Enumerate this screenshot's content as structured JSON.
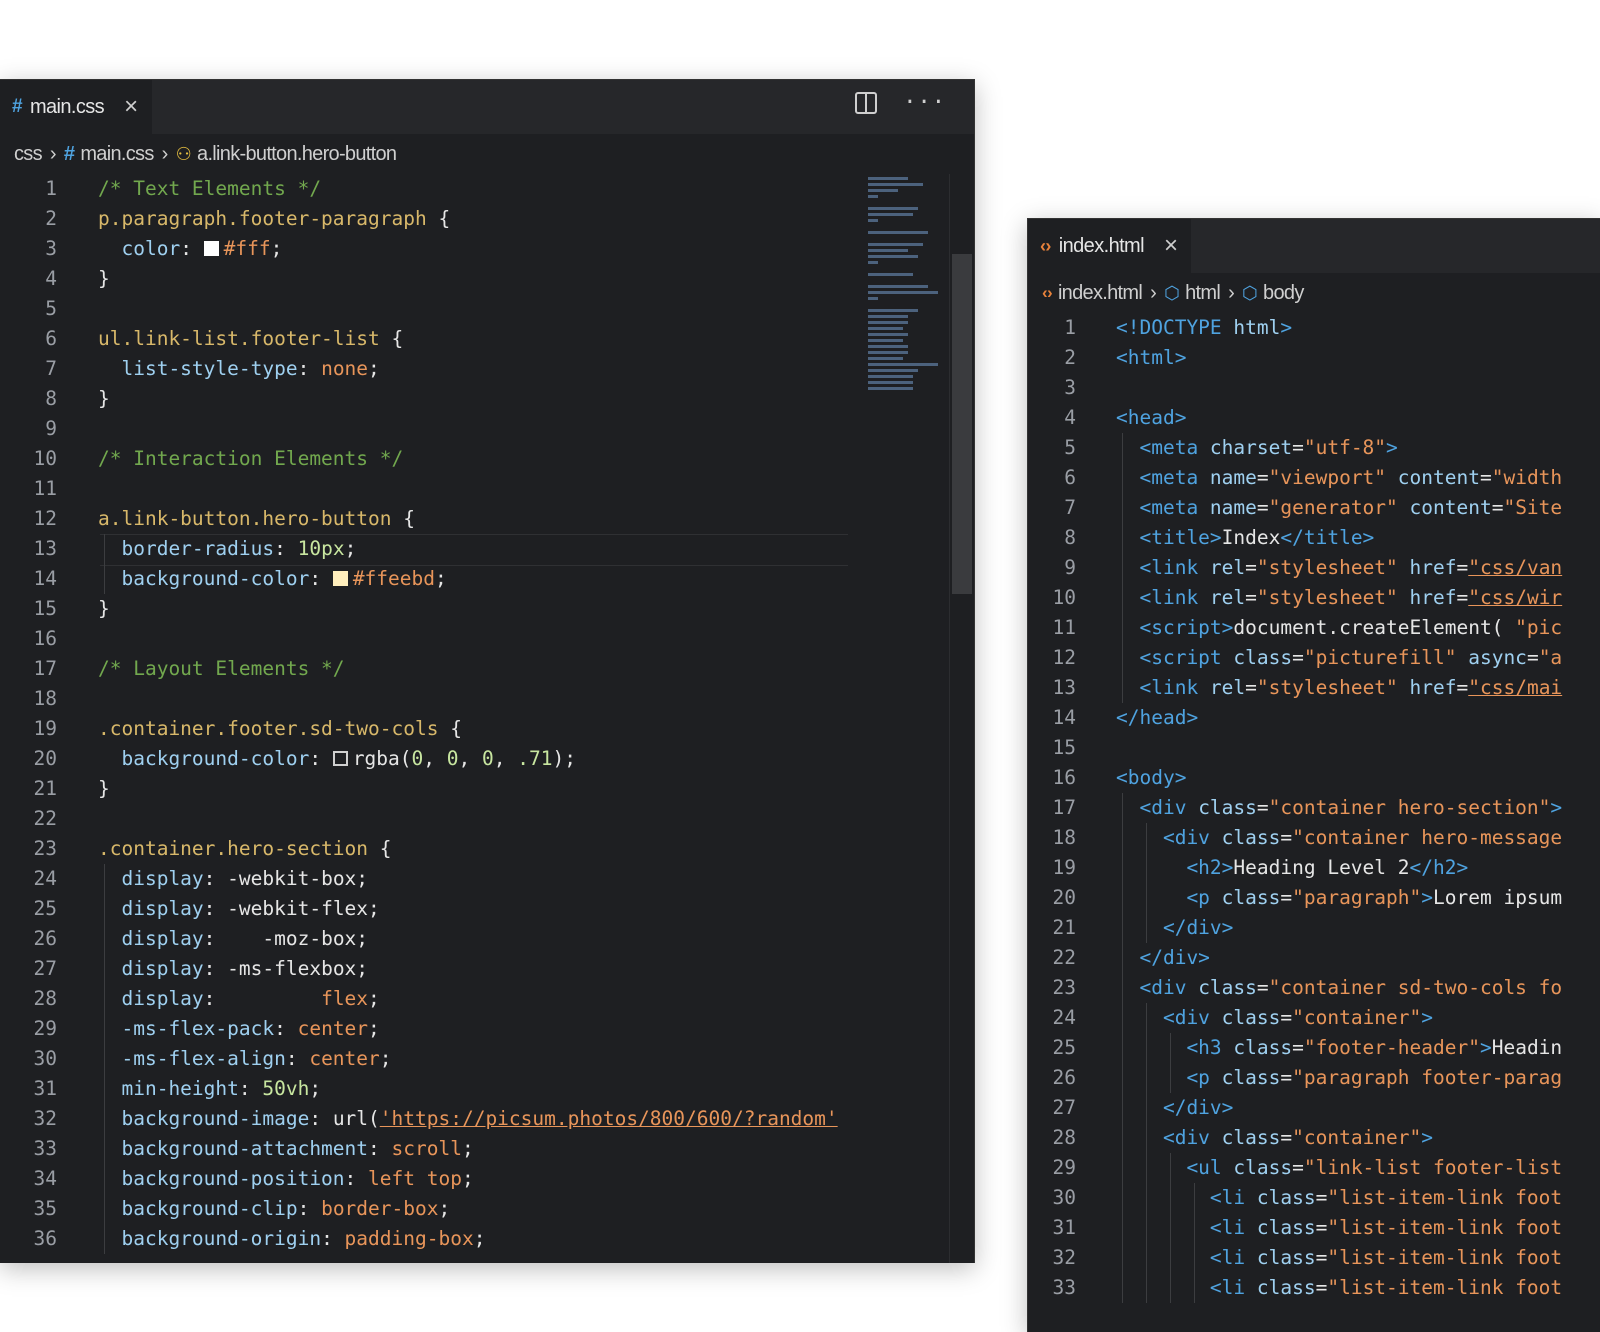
{
  "css_editor": {
    "tab": {
      "label": "main.css",
      "icon": "css-hash-icon"
    },
    "breadcrumb": [
      "css",
      "main.css",
      "a.link-button.hero-button"
    ],
    "lines": [
      {
        "n": "1",
        "parts": [
          [
            "cm",
            "/* Text Elements */"
          ]
        ]
      },
      {
        "n": "2",
        "parts": [
          [
            "sel",
            "p.paragraph.footer-paragraph"
          ],
          [
            "br",
            " {"
          ]
        ]
      },
      {
        "n": "3",
        "parts": [
          [
            "pr",
            "  color"
          ],
          [
            "br",
            ": "
          ],
          [
            "sw",
            "#ffffff"
          ],
          [
            "vl",
            "#fff"
          ],
          [
            "br",
            ";"
          ]
        ]
      },
      {
        "n": "4",
        "parts": [
          [
            "br",
            "}"
          ]
        ]
      },
      {
        "n": "5",
        "parts": []
      },
      {
        "n": "6",
        "parts": [
          [
            "sel",
            "ul.link-list.footer-list"
          ],
          [
            "br",
            " {"
          ]
        ]
      },
      {
        "n": "7",
        "parts": [
          [
            "pr",
            "  list-style-type"
          ],
          [
            "br",
            ": "
          ],
          [
            "vl",
            "none"
          ],
          [
            "br",
            ";"
          ]
        ]
      },
      {
        "n": "8",
        "parts": [
          [
            "br",
            "}"
          ]
        ]
      },
      {
        "n": "9",
        "parts": []
      },
      {
        "n": "10",
        "parts": [
          [
            "cm",
            "/* Interaction Elements */"
          ]
        ]
      },
      {
        "n": "11",
        "parts": []
      },
      {
        "n": "12",
        "parts": [
          [
            "sel",
            "a.link-button.hero-button"
          ],
          [
            "br",
            " {"
          ]
        ]
      },
      {
        "n": "13",
        "parts": [
          [
            "pr",
            "  border-radius"
          ],
          [
            "br",
            ": "
          ],
          [
            "nm",
            "10px"
          ],
          [
            "br",
            ";"
          ]
        ]
      },
      {
        "n": "14",
        "parts": [
          [
            "pr",
            "  background-color"
          ],
          [
            "br",
            ": "
          ],
          [
            "sw",
            "#ffeebd"
          ],
          [
            "vl",
            "#ffeebd"
          ],
          [
            "br",
            ";"
          ]
        ]
      },
      {
        "n": "15",
        "parts": [
          [
            "br",
            "}"
          ]
        ]
      },
      {
        "n": "16",
        "parts": []
      },
      {
        "n": "17",
        "parts": [
          [
            "cm",
            "/* Layout Elements */"
          ]
        ]
      },
      {
        "n": "18",
        "parts": []
      },
      {
        "n": "19",
        "parts": [
          [
            "sel",
            ".container.footer.sd-two-cols"
          ],
          [
            "br",
            " {"
          ]
        ]
      },
      {
        "n": "20",
        "parts": [
          [
            "pr",
            "  background-color"
          ],
          [
            "br",
            ": "
          ],
          [
            "sw",
            "empty"
          ],
          [
            "tx",
            "rgba("
          ],
          [
            "nm",
            "0"
          ],
          [
            "tx",
            ", "
          ],
          [
            "nm",
            "0"
          ],
          [
            "tx",
            ", "
          ],
          [
            "nm",
            "0"
          ],
          [
            "tx",
            ", "
          ],
          [
            "nm",
            ".71"
          ],
          [
            "tx",
            ")"
          ],
          [
            "br",
            ";"
          ]
        ]
      },
      {
        "n": "21",
        "parts": [
          [
            "br",
            "}"
          ]
        ]
      },
      {
        "n": "22",
        "parts": []
      },
      {
        "n": "23",
        "parts": [
          [
            "sel",
            ".container.hero-section"
          ],
          [
            "br",
            " {"
          ]
        ]
      },
      {
        "n": "24",
        "parts": [
          [
            "pr",
            "  display"
          ],
          [
            "br",
            ": "
          ],
          [
            "tx",
            "-webkit-box"
          ],
          [
            "br",
            ";"
          ]
        ]
      },
      {
        "n": "25",
        "parts": [
          [
            "pr",
            "  display"
          ],
          [
            "br",
            ": "
          ],
          [
            "tx",
            "-webkit-flex"
          ],
          [
            "br",
            ";"
          ]
        ]
      },
      {
        "n": "26",
        "parts": [
          [
            "pr",
            "  display"
          ],
          [
            "br",
            ":    "
          ],
          [
            "tx",
            "-moz-box"
          ],
          [
            "br",
            ";"
          ]
        ]
      },
      {
        "n": "27",
        "parts": [
          [
            "pr",
            "  display"
          ],
          [
            "br",
            ": "
          ],
          [
            "tx",
            "-ms-flexbox"
          ],
          [
            "br",
            ";"
          ]
        ]
      },
      {
        "n": "28",
        "parts": [
          [
            "pr",
            "  display"
          ],
          [
            "br",
            ":         "
          ],
          [
            "vl",
            "flex"
          ],
          [
            "br",
            ";"
          ]
        ]
      },
      {
        "n": "29",
        "parts": [
          [
            "pr",
            "  -ms-flex-pack"
          ],
          [
            "br",
            ": "
          ],
          [
            "vl",
            "center"
          ],
          [
            "br",
            ";"
          ]
        ]
      },
      {
        "n": "30",
        "parts": [
          [
            "pr",
            "  -ms-flex-align"
          ],
          [
            "br",
            ": "
          ],
          [
            "vl",
            "center"
          ],
          [
            "br",
            ";"
          ]
        ]
      },
      {
        "n": "31",
        "parts": [
          [
            "pr",
            "  min-height"
          ],
          [
            "br",
            ": "
          ],
          [
            "nm",
            "50vh"
          ],
          [
            "br",
            ";"
          ]
        ]
      },
      {
        "n": "32",
        "parts": [
          [
            "pr",
            "  background-image"
          ],
          [
            "br",
            ": "
          ],
          [
            "tx",
            "url("
          ],
          [
            "url",
            "'https://picsum.photos/800/600/?random'"
          ]
        ]
      },
      {
        "n": "33",
        "parts": [
          [
            "pr",
            "  background-attachment"
          ],
          [
            "br",
            ": "
          ],
          [
            "vl",
            "scroll"
          ],
          [
            "br",
            ";"
          ]
        ]
      },
      {
        "n": "34",
        "parts": [
          [
            "pr",
            "  background-position"
          ],
          [
            "br",
            ": "
          ],
          [
            "vl",
            "left top"
          ],
          [
            "br",
            ";"
          ]
        ]
      },
      {
        "n": "35",
        "parts": [
          [
            "pr",
            "  background-clip"
          ],
          [
            "br",
            ": "
          ],
          [
            "vl",
            "border-box"
          ],
          [
            "br",
            ";"
          ]
        ]
      },
      {
        "n": "36",
        "parts": [
          [
            "pr",
            "  background-origin"
          ],
          [
            "br",
            ": "
          ],
          [
            "vl",
            "padding-box"
          ],
          [
            "br",
            ";"
          ]
        ]
      }
    ]
  },
  "html_editor": {
    "tab": {
      "label": "index.html",
      "icon": "html-file-icon"
    },
    "breadcrumb": [
      "index.html",
      "html",
      "body"
    ],
    "lines": [
      {
        "n": "1",
        "parts": [
          [
            "tg",
            "<!DOCTYPE "
          ],
          [
            "at",
            "html"
          ],
          [
            "tg",
            ">"
          ]
        ]
      },
      {
        "n": "2",
        "parts": [
          [
            "tg",
            "<html>"
          ]
        ]
      },
      {
        "n": "3",
        "parts": []
      },
      {
        "n": "4",
        "parts": [
          [
            "tg",
            "<head>"
          ]
        ]
      },
      {
        "n": "5",
        "parts": [
          [
            "tg",
            "  <meta "
          ],
          [
            "at",
            "charset"
          ],
          [
            "tx",
            "="
          ],
          [
            "st",
            "\"utf-8\""
          ],
          [
            "tg",
            ">"
          ]
        ]
      },
      {
        "n": "6",
        "parts": [
          [
            "tg",
            "  <meta "
          ],
          [
            "at",
            "name"
          ],
          [
            "tx",
            "="
          ],
          [
            "st",
            "\"viewport\""
          ],
          [
            "at",
            " content"
          ],
          [
            "tx",
            "="
          ],
          [
            "st",
            "\"width"
          ]
        ]
      },
      {
        "n": "7",
        "parts": [
          [
            "tg",
            "  <meta "
          ],
          [
            "at",
            "name"
          ],
          [
            "tx",
            "="
          ],
          [
            "st",
            "\"generator\""
          ],
          [
            "at",
            " content"
          ],
          [
            "tx",
            "="
          ],
          [
            "st",
            "\"Site"
          ]
        ]
      },
      {
        "n": "8",
        "parts": [
          [
            "tg",
            "  <title>"
          ],
          [
            "tx",
            "Index"
          ],
          [
            "tg",
            "</title>"
          ]
        ]
      },
      {
        "n": "9",
        "parts": [
          [
            "tg",
            "  <link "
          ],
          [
            "at",
            "rel"
          ],
          [
            "tx",
            "="
          ],
          [
            "st",
            "\"stylesheet\""
          ],
          [
            "at",
            " href"
          ],
          [
            "tx",
            "="
          ],
          [
            "url",
            "\"css/van"
          ]
        ]
      },
      {
        "n": "10",
        "parts": [
          [
            "tg",
            "  <link "
          ],
          [
            "at",
            "rel"
          ],
          [
            "tx",
            "="
          ],
          [
            "st",
            "\"stylesheet\""
          ],
          [
            "at",
            " href"
          ],
          [
            "tx",
            "="
          ],
          [
            "url",
            "\"css/wir"
          ]
        ]
      },
      {
        "n": "11",
        "parts": [
          [
            "tg",
            "  <script>"
          ],
          [
            "tx",
            "document.createElement( "
          ],
          [
            "st",
            "\"pic"
          ]
        ]
      },
      {
        "n": "12",
        "parts": [
          [
            "tg",
            "  <script "
          ],
          [
            "at",
            "class"
          ],
          [
            "tx",
            "="
          ],
          [
            "st",
            "\"picturefill\""
          ],
          [
            "at",
            " async"
          ],
          [
            "tx",
            "="
          ],
          [
            "st",
            "\"a"
          ]
        ]
      },
      {
        "n": "13",
        "parts": [
          [
            "tg",
            "  <link "
          ],
          [
            "at",
            "rel"
          ],
          [
            "tx",
            "="
          ],
          [
            "st",
            "\"stylesheet\""
          ],
          [
            "at",
            " href"
          ],
          [
            "tx",
            "="
          ],
          [
            "url",
            "\"css/mai"
          ]
        ]
      },
      {
        "n": "14",
        "parts": [
          [
            "tg",
            "</head>"
          ]
        ]
      },
      {
        "n": "15",
        "parts": []
      },
      {
        "n": "16",
        "parts": [
          [
            "tg",
            "<body>"
          ]
        ]
      },
      {
        "n": "17",
        "parts": [
          [
            "tg",
            "  <div "
          ],
          [
            "at",
            "class"
          ],
          [
            "tx",
            "="
          ],
          [
            "st",
            "\"container hero-section\""
          ],
          [
            "tg",
            ">"
          ]
        ]
      },
      {
        "n": "18",
        "parts": [
          [
            "tg",
            "    <div "
          ],
          [
            "at",
            "class"
          ],
          [
            "tx",
            "="
          ],
          [
            "st",
            "\"container hero-message"
          ]
        ]
      },
      {
        "n": "19",
        "parts": [
          [
            "tg",
            "      <h2>"
          ],
          [
            "tx",
            "Heading Level 2"
          ],
          [
            "tg",
            "</h2>"
          ]
        ]
      },
      {
        "n": "20",
        "parts": [
          [
            "tg",
            "      <p "
          ],
          [
            "at",
            "class"
          ],
          [
            "tx",
            "="
          ],
          [
            "st",
            "\"paragraph\""
          ],
          [
            "tg",
            ">"
          ],
          [
            "tx",
            "Lorem ipsum"
          ]
        ]
      },
      {
        "n": "21",
        "parts": [
          [
            "tg",
            "    </div>"
          ]
        ]
      },
      {
        "n": "22",
        "parts": [
          [
            "tg",
            "  </div>"
          ]
        ]
      },
      {
        "n": "23",
        "parts": [
          [
            "tg",
            "  <div "
          ],
          [
            "at",
            "class"
          ],
          [
            "tx",
            "="
          ],
          [
            "st",
            "\"container sd-two-cols fo"
          ]
        ]
      },
      {
        "n": "24",
        "parts": [
          [
            "tg",
            "    <div "
          ],
          [
            "at",
            "class"
          ],
          [
            "tx",
            "="
          ],
          [
            "st",
            "\"container\""
          ],
          [
            "tg",
            ">"
          ]
        ]
      },
      {
        "n": "25",
        "parts": [
          [
            "tg",
            "      <h3 "
          ],
          [
            "at",
            "class"
          ],
          [
            "tx",
            "="
          ],
          [
            "st",
            "\"footer-header\""
          ],
          [
            "tg",
            ">"
          ],
          [
            "tx",
            "Headin"
          ]
        ]
      },
      {
        "n": "26",
        "parts": [
          [
            "tg",
            "      <p "
          ],
          [
            "at",
            "class"
          ],
          [
            "tx",
            "="
          ],
          [
            "st",
            "\"paragraph footer-parag"
          ]
        ]
      },
      {
        "n": "27",
        "parts": [
          [
            "tg",
            "    </div>"
          ]
        ]
      },
      {
        "n": "28",
        "parts": [
          [
            "tg",
            "    <div "
          ],
          [
            "at",
            "class"
          ],
          [
            "tx",
            "="
          ],
          [
            "st",
            "\"container\""
          ],
          [
            "tg",
            ">"
          ]
        ]
      },
      {
        "n": "29",
        "parts": [
          [
            "tg",
            "      <ul "
          ],
          [
            "at",
            "class"
          ],
          [
            "tx",
            "="
          ],
          [
            "st",
            "\"link-list footer-list"
          ]
        ]
      },
      {
        "n": "30",
        "parts": [
          [
            "tg",
            "        <li "
          ],
          [
            "at",
            "class"
          ],
          [
            "tx",
            "="
          ],
          [
            "st",
            "\"list-item-link foot"
          ]
        ]
      },
      {
        "n": "31",
        "parts": [
          [
            "tg",
            "        <li "
          ],
          [
            "at",
            "class"
          ],
          [
            "tx",
            "="
          ],
          [
            "st",
            "\"list-item-link foot"
          ]
        ]
      },
      {
        "n": "32",
        "parts": [
          [
            "tg",
            "        <li "
          ],
          [
            "at",
            "class"
          ],
          [
            "tx",
            "="
          ],
          [
            "st",
            "\"list-item-link foot"
          ]
        ]
      },
      {
        "n": "33",
        "parts": [
          [
            "tg",
            "        <li "
          ],
          [
            "at",
            "class"
          ],
          [
            "tx",
            "="
          ],
          [
            "st",
            "\"list-item-link foot"
          ]
        ]
      }
    ]
  }
}
